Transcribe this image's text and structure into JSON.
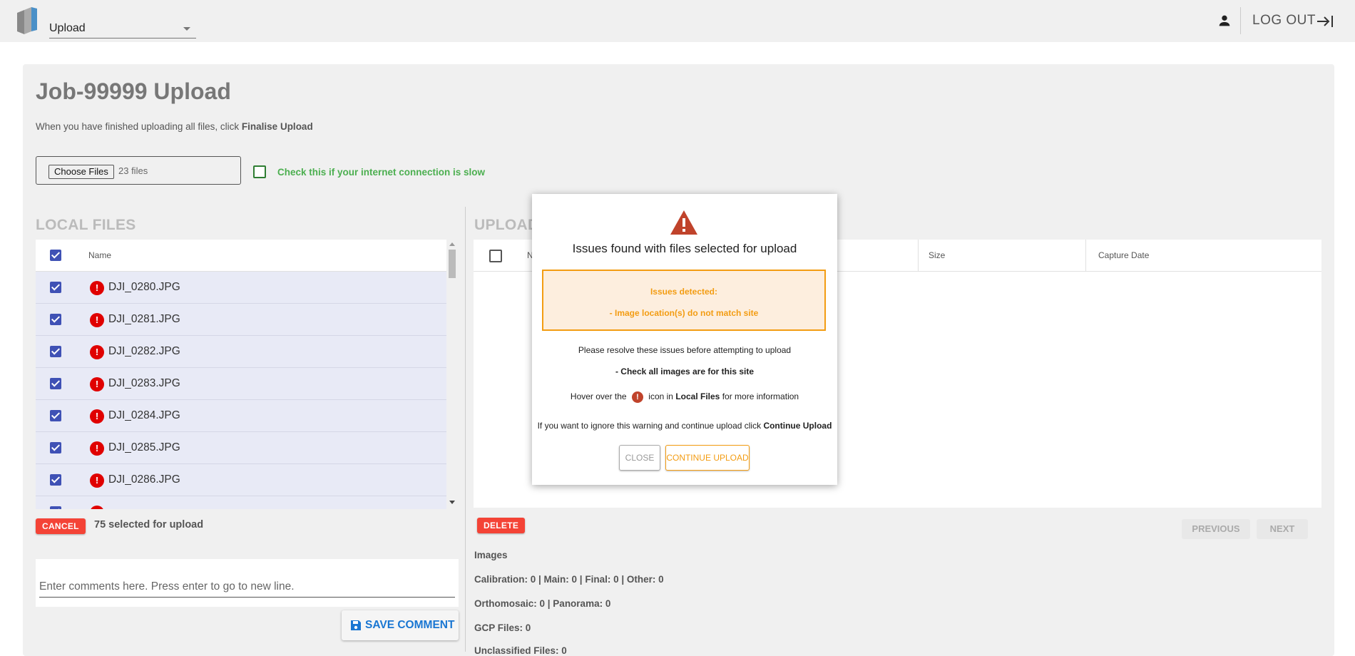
{
  "header": {
    "page_select_value": "Upload",
    "logout_label": "LOG OUT"
  },
  "main": {
    "title": "Job-99999 Upload",
    "instructions_prefix": "When you have finished uploading all files, click ",
    "instructions_bold": "Finalise Upload",
    "choose_files_label": "Choose Files",
    "files_count": "23 files",
    "slow_connection_label": "Check this if your internet connection is slow"
  },
  "local_files": {
    "heading": "LOCAL FILES",
    "name_header": "Name",
    "files": [
      "DJI_0280.JPG",
      "DJI_0281.JPG",
      "DJI_0282.JPG",
      "DJI_0283.JPG",
      "DJI_0284.JPG",
      "DJI_0285.JPG",
      "DJI_0286.JPG"
    ],
    "error_glyph": "!",
    "cancel_label": "CANCEL",
    "selected_text": "75 selected for upload",
    "comment_placeholder": "Enter comments here. Press enter to go to new line.",
    "save_comment_label": "SAVE COMMENT"
  },
  "uploaded": {
    "heading": "UPLOAD",
    "col_name_partial": "N",
    "col_size": "Size",
    "col_capture_date": "Capture Date",
    "delete_label": "DELETE",
    "previous_label": "PREVIOUS",
    "next_label": "NEXT",
    "stats": {
      "images_heading": "Images",
      "calibration": "Calibration: 0 | Main: 0 | Final: 0 | Other: 0",
      "ortho": "Orthomosaic: 0 | Panorama: 0",
      "gcp": "GCP Files: 0",
      "unclassified": "Unclassified Files: 0"
    }
  },
  "modal": {
    "title": "Issues found with files selected for upload",
    "issues_heading": "Issues detected:",
    "issue_1": "- Image location(s) do not match site",
    "resolve_text": "Please resolve these issues before attempting to upload",
    "check_text": "- Check all images are for this site",
    "hover_prefix": "Hover over the",
    "hover_mid": "icon in",
    "hover_bold": "Local Files",
    "hover_suffix": "for more information",
    "ignore_prefix": "If you want to ignore this warning and continue upload click",
    "ignore_bold": "Continue Upload",
    "close_label": "CLOSE",
    "continue_label": "CONTINUE UPLOAD"
  },
  "colors": {
    "accent_blue": "#3f51b5",
    "danger_red": "#f44336",
    "warning_orange": "#f39c12",
    "success_green": "#4caf50"
  }
}
